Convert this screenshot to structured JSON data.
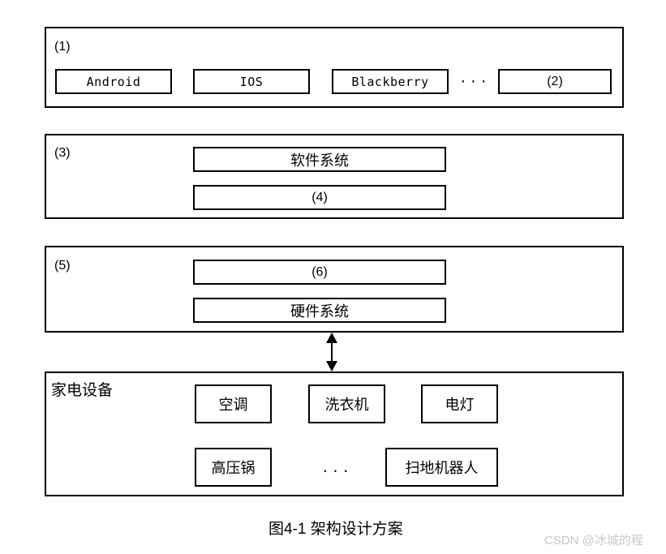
{
  "figure": {
    "caption": "图4-1 架构设计方案",
    "watermark": "CSDN @冰城的程"
  },
  "layers": {
    "os_layer": {
      "label": "(1)",
      "items": [
        {
          "text": "Android",
          "style": "mono"
        },
        {
          "text": "IOS",
          "style": "mono"
        },
        {
          "text": "Blackberry",
          "style": "mono"
        },
        {
          "text": "(2)",
          "style": "num"
        }
      ],
      "ellipsis": "···"
    },
    "software_layer": {
      "label": "(3)",
      "items": [
        {
          "text": "软件系统",
          "style": "cjk"
        },
        {
          "text": "(4)",
          "style": "num"
        }
      ]
    },
    "hardware_layer": {
      "label": "(5)",
      "items": [
        {
          "text": "(6)",
          "style": "num"
        },
        {
          "text": "硬件系统",
          "style": "cjk"
        }
      ]
    },
    "appliance_layer": {
      "label": "家电设备",
      "row1": [
        {
          "text": "空调",
          "style": "cjk"
        },
        {
          "text": "洗衣机",
          "style": "cjk"
        },
        {
          "text": "电灯",
          "style": "cjk"
        }
      ],
      "row2": [
        {
          "text": "高压锅",
          "style": "cjk"
        },
        {
          "text": "扫地机器人",
          "style": "cjk"
        }
      ],
      "ellipsis": "..."
    }
  },
  "connector": {
    "name": "bidirectional-arrow",
    "direction": "both"
  },
  "colors": {
    "stroke": "#000000",
    "background": "#ffffff",
    "watermark": "#c8c8c8"
  }
}
